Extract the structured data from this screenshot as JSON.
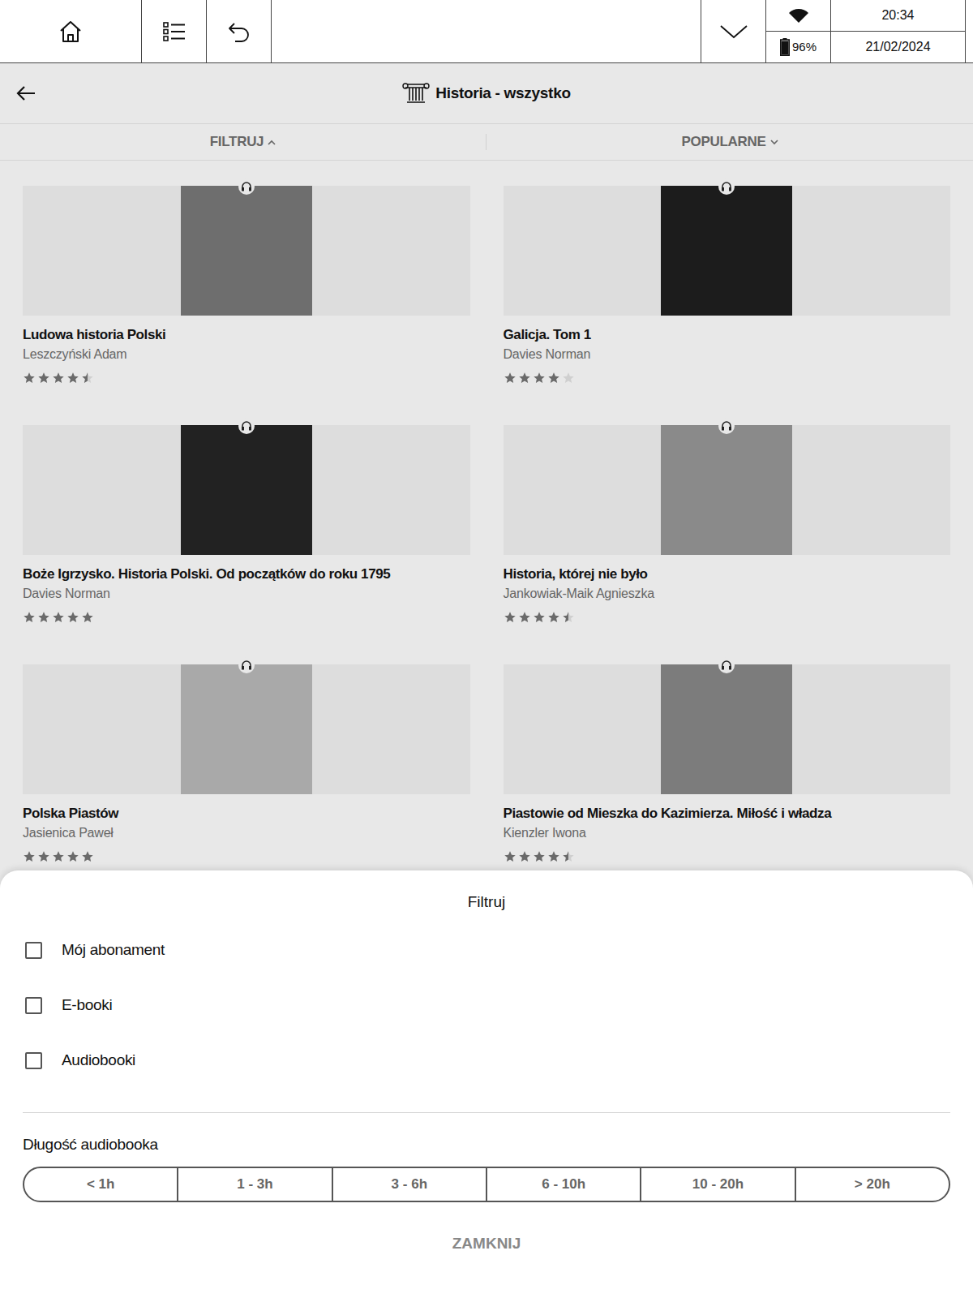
{
  "status_bar": {
    "time": "20:34",
    "date": "21/02/2024",
    "battery": "96%",
    "battery_level": 0.96,
    "wifi_on": true
  },
  "header": {
    "title": "Historia - wszystko"
  },
  "toolbar": {
    "filter": {
      "label": "FILTRUJ",
      "expanded": true
    },
    "sort": {
      "label": "POPULARNE",
      "expanded": false
    }
  },
  "books": [
    {
      "title": "Ludowa historia Polski",
      "author": "Leszczyński Adam",
      "stars": 4.5,
      "kind": "audiobook",
      "color": "#6e6e6e"
    },
    {
      "title": "Galicja. Tom 1",
      "author": "Davies Norman",
      "stars": 4,
      "kind": "audiobook",
      "color": "#1c1c1c"
    },
    {
      "title": "Boże Igrzysko. Historia Polski. Od początków do roku 1795",
      "author": "Davies Norman",
      "stars": 5,
      "kind": "audiobook",
      "color": "#222222"
    },
    {
      "title": "Historia, której nie było",
      "author": "Jankowiak-Maik Agnieszka",
      "stars": 4.5,
      "kind": "audiobook",
      "color": "#8a8a8a"
    },
    {
      "title": "Polska Piastów",
      "author": "Jasienica Paweł",
      "stars": 5,
      "kind": "audiobook",
      "color": "#a9a9a9"
    },
    {
      "title": "Piastowie od Mieszka do Kazimierza. Miłość i władza",
      "author": "Kienzler Iwona",
      "stars": 4.5,
      "kind": "audiobook",
      "color": "#7c7c7c"
    }
  ],
  "filter_sheet": {
    "title": "Filtruj",
    "options": [
      {
        "label": "Mój abonament",
        "checked": false
      },
      {
        "label": "E-booki",
        "checked": false
      },
      {
        "label": "Audiobooki",
        "checked": false
      }
    ],
    "length_label": "Długość audiobooka",
    "lengths": [
      {
        "label": "< 1h",
        "selected": false
      },
      {
        "label": "1 - 3h",
        "selected": false
      },
      {
        "label": "3 - 6h",
        "selected": false
      },
      {
        "label": "6 - 10h",
        "selected": false
      },
      {
        "label": "10 - 20h",
        "selected": false
      },
      {
        "label": "> 20h",
        "selected": false
      }
    ],
    "close": "ZAMKNIJ"
  }
}
